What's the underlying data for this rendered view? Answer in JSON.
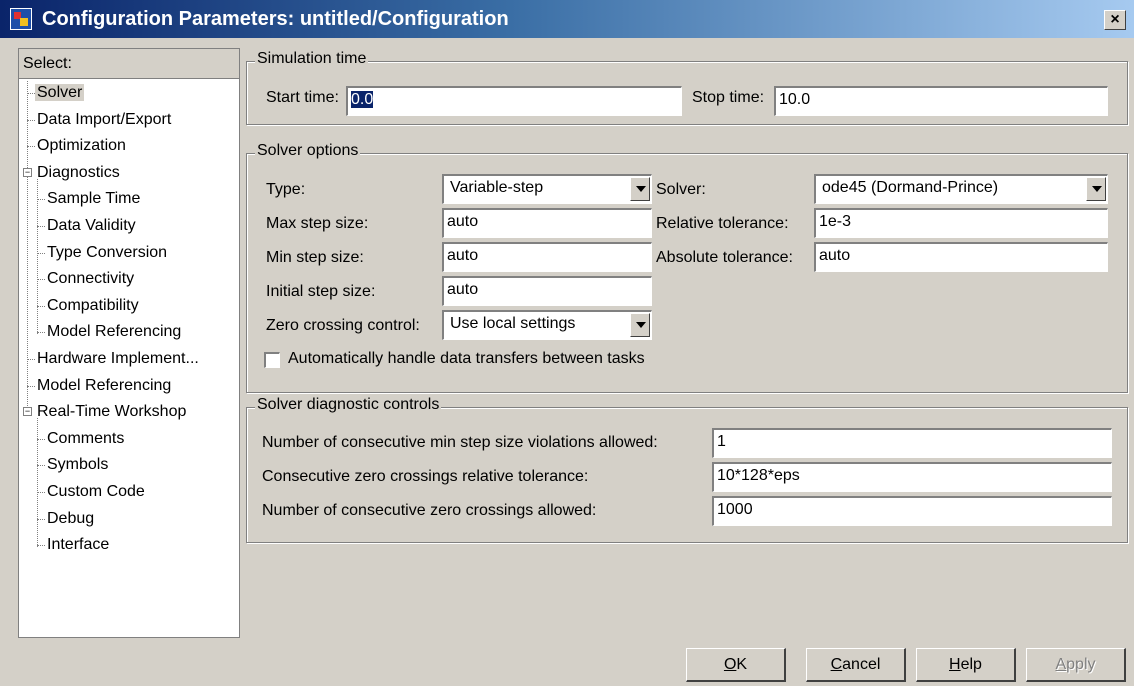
{
  "window": {
    "title": "Configuration Parameters: untitled/Configuration",
    "close_label": "×"
  },
  "tree": {
    "header": "Select:",
    "items": [
      {
        "label": "Solver",
        "selected": true
      },
      {
        "label": "Data Import/Export"
      },
      {
        "label": "Optimization"
      },
      {
        "label": "Diagnostics",
        "expander": "−"
      },
      {
        "label": "Sample Time"
      },
      {
        "label": "Data Validity"
      },
      {
        "label": "Type Conversion"
      },
      {
        "label": "Connectivity"
      },
      {
        "label": "Compatibility"
      },
      {
        "label": "Model Referencing"
      },
      {
        "label": "Hardware Implement..."
      },
      {
        "label": "Model Referencing"
      },
      {
        "label": "Real-Time Workshop",
        "expander": "−"
      },
      {
        "label": "Comments"
      },
      {
        "label": "Symbols"
      },
      {
        "label": "Custom Code"
      },
      {
        "label": "Debug"
      },
      {
        "label": "Interface"
      }
    ]
  },
  "sim_time": {
    "title": "Simulation time",
    "start_label": "Start time:",
    "start_value": "0.0",
    "stop_label": "Stop time:",
    "stop_value": "10.0"
  },
  "solver_options": {
    "title": "Solver options",
    "type_label": "Type:",
    "type_value": "Variable-step",
    "solver_label": "Solver:",
    "solver_value": "ode45 (Dormand-Prince)",
    "max_step_label": "Max step size:",
    "max_step_value": "auto",
    "rel_tol_label": "Relative tolerance:",
    "rel_tol_value": "1e-3",
    "min_step_label": "Min step size:",
    "min_step_value": "auto",
    "abs_tol_label": "Absolute tolerance:",
    "abs_tol_value": "auto",
    "init_step_label": "Initial step size:",
    "init_step_value": "auto",
    "zero_cross_label": "Zero crossing control:",
    "zero_cross_value": "Use local settings",
    "auto_transfer_label": "Automatically handle data transfers between tasks",
    "auto_transfer_checked": false
  },
  "diag": {
    "title": "Solver diagnostic controls",
    "min_step_viol_label": "Number of consecutive min step size violations allowed:",
    "min_step_viol_value": "1",
    "zc_rel_tol_label": "Consecutive zero crossings relative tolerance:",
    "zc_rel_tol_value": "10*128*eps",
    "zc_allowed_label": "Number of consecutive zero crossings allowed:",
    "zc_allowed_value": "1000"
  },
  "buttons": {
    "ok": {
      "pre": "",
      "key": "O",
      "post": "K"
    },
    "cancel": {
      "pre": "",
      "key": "C",
      "post": "ancel"
    },
    "help": {
      "pre": "",
      "key": "H",
      "post": "elp"
    },
    "apply": {
      "pre": "",
      "key": "A",
      "post": "pply",
      "disabled": true
    }
  }
}
